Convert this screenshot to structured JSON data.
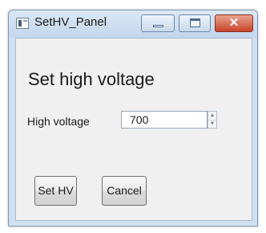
{
  "window": {
    "title": "SetHV_Panel",
    "icons": {
      "app": "app-window-icon",
      "minimize": "minimize-icon",
      "maximize": "maximize-icon",
      "close": "close-icon"
    },
    "colors": {
      "close_button": "#c8442a",
      "titlebar": "#c3d6ec",
      "client_background": "#f0f0f0"
    }
  },
  "panel": {
    "heading": "Set high voltage",
    "voltage": {
      "label": "High voltage",
      "value": "700"
    },
    "buttons": {
      "set": "Set HV",
      "cancel": "Cancel"
    }
  }
}
